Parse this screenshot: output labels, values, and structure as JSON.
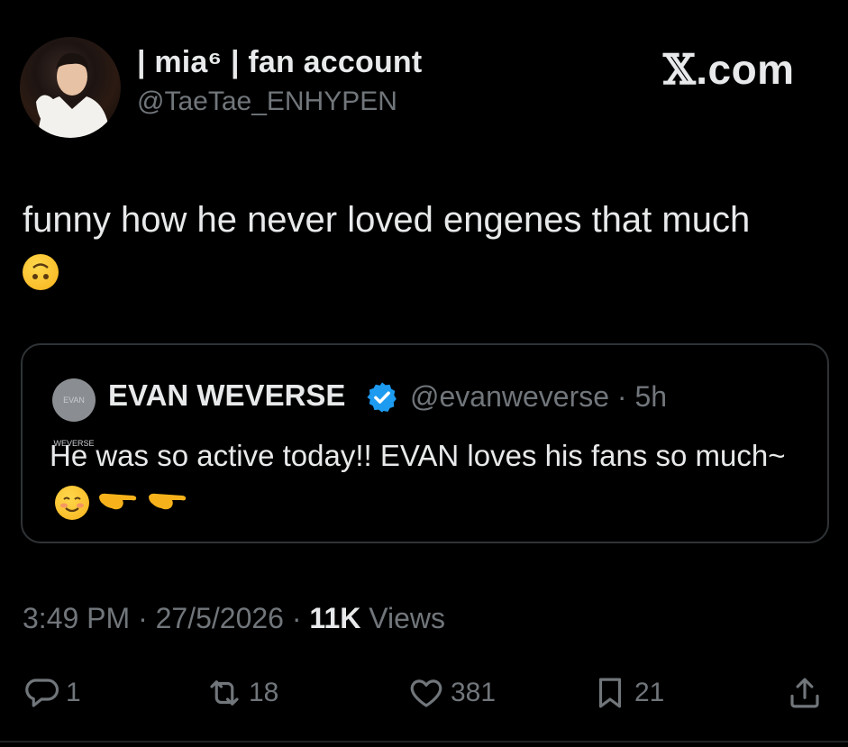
{
  "brand": {
    "label_x": "𝕏",
    "label_com": ".com"
  },
  "tweet": {
    "display_name": "| mia⁶ | fan account",
    "handle": "@TaeTae_ENHYPEN",
    "text": "funny how he never loved engenes that much",
    "emoji": "upside-down-face-emoji"
  },
  "quoted": {
    "display_name": "EVAN WEVERSE",
    "handle": "@evanweverse · 5h",
    "avatar_text": "EVAN WEVERSE",
    "text": "He was so active today!! EVAN loves his fans so much~",
    "emojis": [
      "smiling-face-emoji",
      "pointing-hand-emoji",
      "pointing-hand-emoji"
    ]
  },
  "meta": {
    "time": "3:49 PM · 27/5/2026 · ",
    "views_count": "11K",
    "views_label": " Views"
  },
  "actions": {
    "replies": "1",
    "reposts": "18",
    "likes": "381",
    "bookmarks": "21"
  },
  "colors": {
    "background": "#000000",
    "text": "#e7e9ea",
    "muted": "#71767b",
    "verified": "#1d9bf0",
    "border": "#2f3336"
  }
}
